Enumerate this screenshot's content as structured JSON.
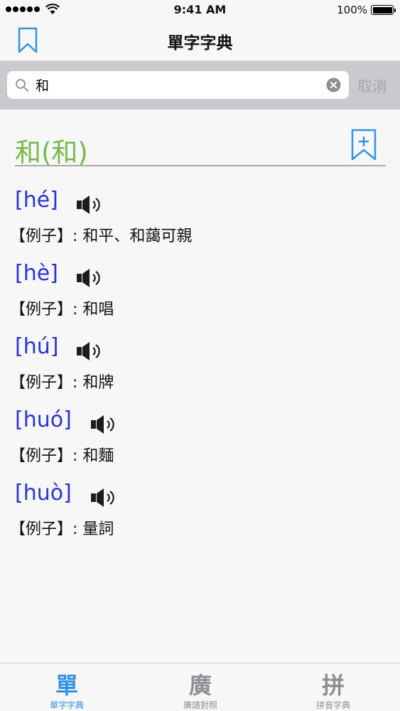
{
  "status_bar": {
    "time": "9:41 AM",
    "battery": "100%"
  },
  "nav": {
    "title": "單字字典"
  },
  "search": {
    "value": "和",
    "cancel": "取消"
  },
  "headword": "和(和)",
  "entries": [
    {
      "pinyin": "[hé]",
      "example": "【例子】: 和平、和藹可親"
    },
    {
      "pinyin": "[hè]",
      "example": "【例子】: 和唱"
    },
    {
      "pinyin": "[hú]",
      "example": "【例子】: 和牌"
    },
    {
      "pinyin": "[huó]",
      "example": "【例子】: 和麵"
    },
    {
      "pinyin": "[huò]",
      "example": "【例子】: 量詞"
    }
  ],
  "tabs": [
    {
      "icon": "單",
      "label": "單字字典",
      "active": true
    },
    {
      "icon": "廣",
      "label": "廣譜對照",
      "active": false
    },
    {
      "icon": "拼",
      "label": "拼音字典",
      "active": false
    }
  ],
  "colors": {
    "accent": "#3291e4",
    "headword": "#78b94a",
    "pinyin": "#2a33d8"
  },
  "icons": {
    "nav_left": "bookmark-icon",
    "headword_action": "add-bookmark-icon",
    "entry_action": "speaker-icon",
    "search": "search-icon",
    "clear": "clear-icon"
  }
}
